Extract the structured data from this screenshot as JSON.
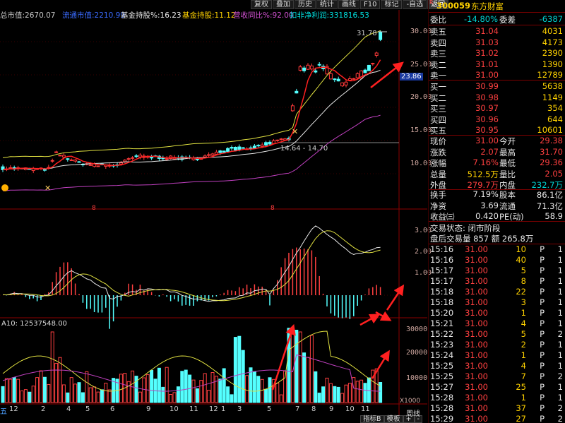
{
  "header": {
    "fields": [
      {
        "label": "总市值:",
        "value": "2670.07",
        "color": "#c8c8c8"
      },
      {
        "label": "流通市值:",
        "value": "2210.99",
        "color": "#3a6bff"
      },
      {
        "label": "基金持股%:",
        "value": "16.23",
        "color": "#e8e8e8"
      },
      {
        "label": "基金持股:",
        "value": "11.12",
        "color": "#ffd200"
      },
      {
        "label": "营收同比%:",
        "value": "92.00",
        "color": "#d050d0"
      },
      {
        "label": "扣非净利润:",
        "value": "331816.53",
        "color": "#00e0e0"
      }
    ],
    "toolbar": [
      "复权",
      "叠加",
      "历史",
      "统计",
      "画线",
      "F10",
      "标记",
      "-自选",
      "返回"
    ]
  },
  "main_chart": {
    "price_axis": [
      "30.00",
      "25.00",
      "20.00",
      "15.00",
      "10.00"
    ],
    "current_price_tag": "23.86",
    "high_label": "31.78",
    "box_label": "14.64 - 14.70",
    "event_marks": [
      "8",
      "8"
    ]
  },
  "macd": {
    "axis": [
      "3.00",
      "2.00",
      "1.00"
    ]
  },
  "volume": {
    "title": "A10: 12537548.00",
    "axis": [
      "30000",
      "20000",
      "10000"
    ],
    "unit": "X1000"
  },
  "date_axis": [
    "五",
    "12",
    "2",
    "4",
    "5",
    "6",
    "9",
    "10",
    "11",
    "12",
    "1",
    "3",
    "5",
    "7",
    "8",
    "9",
    "10",
    "11"
  ],
  "bottom_tabs": [
    "指标B",
    "模板",
    "+",
    "-"
  ],
  "week_label": "周线",
  "stock": {
    "code": "300059",
    "name": "东方财富"
  },
  "ratio": {
    "label1": "委比",
    "value1": "-14.80%",
    "label2": "委差",
    "value2": "-6387"
  },
  "asks": [
    {
      "label": "卖五",
      "price": "31.04",
      "vol": "4031"
    },
    {
      "label": "卖四",
      "price": "31.03",
      "vol": "4173"
    },
    {
      "label": "卖三",
      "price": "31.02",
      "vol": "2390"
    },
    {
      "label": "卖二",
      "price": "31.01",
      "vol": "1390"
    },
    {
      "label": "卖一",
      "price": "31.00",
      "vol": "12789"
    }
  ],
  "bids": [
    {
      "label": "买一",
      "price": "30.99",
      "vol": "5638"
    },
    {
      "label": "买二",
      "price": "30.98",
      "vol": "1149"
    },
    {
      "label": "买三",
      "price": "30.97",
      "vol": "354"
    },
    {
      "label": "买四",
      "price": "30.96",
      "vol": "644"
    },
    {
      "label": "买五",
      "price": "30.95",
      "vol": "10601"
    }
  ],
  "quote": [
    {
      "l1": "现价",
      "v1": "31.00",
      "l2": "今开",
      "v2": "29.38",
      "c1": "#ff4040",
      "c2": "#ff4040"
    },
    {
      "l1": "涨跌",
      "v1": "2.07",
      "l2": "最高",
      "v2": "31.70",
      "c1": "#ff4040",
      "c2": "#ff4040"
    },
    {
      "l1": "涨幅",
      "v1": "7.16%",
      "l2": "最低",
      "v2": "29.36",
      "c1": "#ff4040",
      "c2": "#ff4040"
    },
    {
      "l1": "总量",
      "v1": "512.5万",
      "l2": "量比",
      "v2": "2.05",
      "c1": "#ffd200",
      "c2": "#ff4040"
    },
    {
      "l1": "外盘",
      "v1": "279.7万",
      "l2": "内盘",
      "v2": "232.7万",
      "c1": "#ff4040",
      "c2": "#00d0d0"
    }
  ],
  "fundamentals": [
    {
      "l1": "换手",
      "v1": "7.19%",
      "l2": "股本",
      "v2": "86.1亿"
    },
    {
      "l1": "净资",
      "v1": "3.69",
      "l2": "流通",
      "v2": "71.3亿"
    },
    {
      "l1": "收益㈢",
      "v1": "0.420",
      "l2": "PE(动)",
      "v2": "58.9"
    }
  ],
  "status": {
    "line1": "交易状态: 闭市阶段",
    "line2": "盘后交易量 857 额 265.8万"
  },
  "ticks": [
    {
      "time": "15:16",
      "price": "31.00",
      "vol": "10",
      "flag": "P",
      "n": "1"
    },
    {
      "time": "15:16",
      "price": "31.00",
      "vol": "40",
      "flag": "P",
      "n": "1"
    },
    {
      "time": "15:17",
      "price": "31.00",
      "vol": "5",
      "flag": "P",
      "n": "1"
    },
    {
      "time": "15:17",
      "price": "31.00",
      "vol": "8",
      "flag": "P",
      "n": "1"
    },
    {
      "time": "15:18",
      "price": "31.00",
      "vol": "22",
      "flag": "P",
      "n": "1"
    },
    {
      "time": "15:18",
      "price": "31.00",
      "vol": "3",
      "flag": "P",
      "n": "1"
    },
    {
      "time": "15:20",
      "price": "31.00",
      "vol": "1",
      "flag": "P",
      "n": "1"
    },
    {
      "time": "15:21",
      "price": "31.00",
      "vol": "4",
      "flag": "P",
      "n": "1"
    },
    {
      "time": "15:22",
      "price": "31.00",
      "vol": "5",
      "flag": "P",
      "n": "2"
    },
    {
      "time": "15:23",
      "price": "31.00",
      "vol": "2",
      "flag": "P",
      "n": "1"
    },
    {
      "time": "15:24",
      "price": "31.00",
      "vol": "1",
      "flag": "P",
      "n": "1"
    },
    {
      "time": "15:25",
      "price": "31.00",
      "vol": "4",
      "flag": "P",
      "n": "1"
    },
    {
      "time": "15:25",
      "price": "31.00",
      "vol": "7",
      "flag": "P",
      "n": "2"
    },
    {
      "time": "15:27",
      "price": "31.00",
      "vol": "25",
      "flag": "P",
      "n": "1"
    },
    {
      "time": "15:28",
      "price": "31.00",
      "vol": "1",
      "flag": "P",
      "n": "1"
    },
    {
      "time": "15:28",
      "price": "31.00",
      "vol": "37",
      "flag": "P",
      "n": "2"
    },
    {
      "time": "15:29",
      "price": "31.00",
      "vol": "27",
      "flag": "P",
      "n": "2"
    }
  ]
}
